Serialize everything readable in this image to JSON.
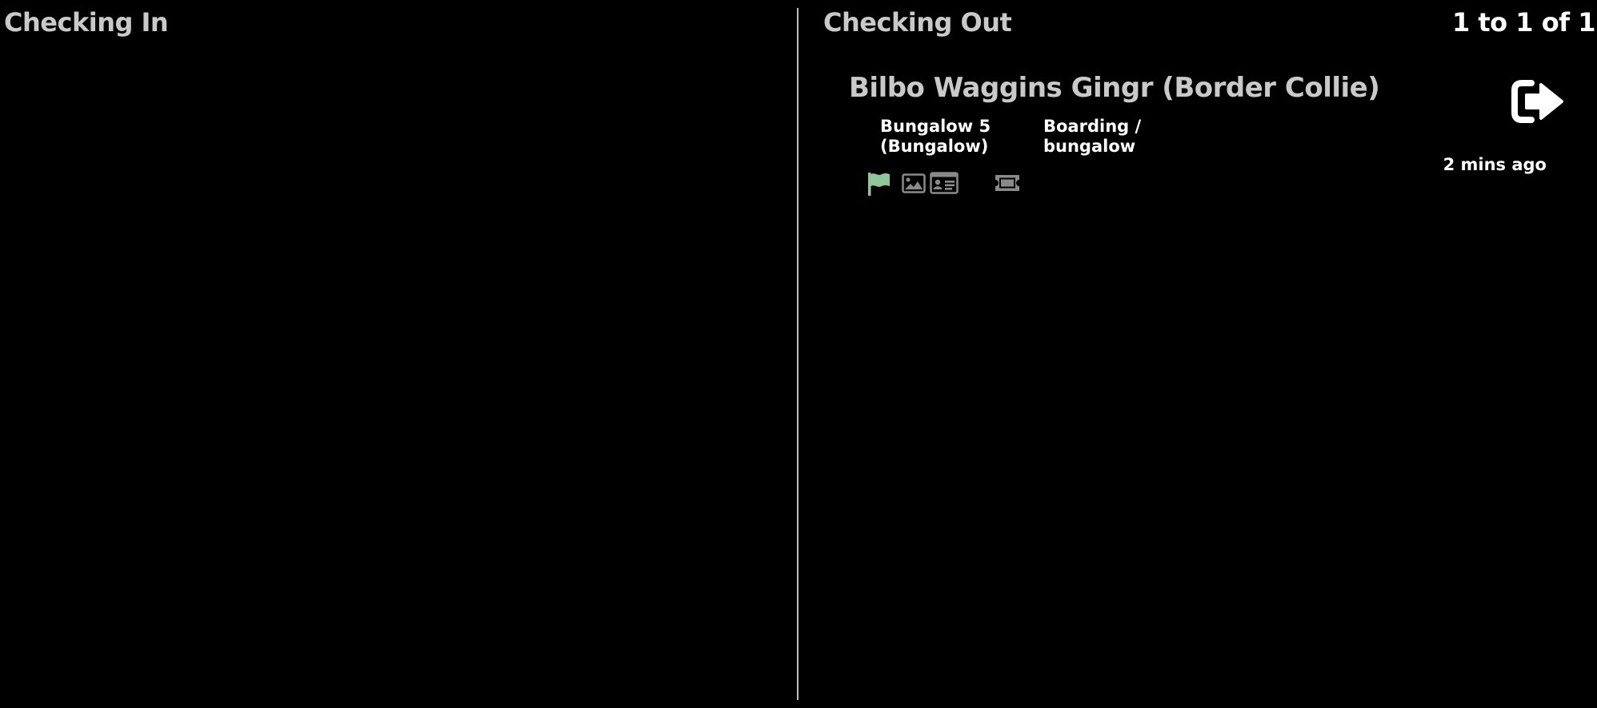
{
  "checking_in": {
    "title": "Checking In"
  },
  "checking_out": {
    "title": "Checking Out",
    "pager": "1 to 1 of 1",
    "items": [
      {
        "name": "Bilbo Waggins Gingr (Border Collie)",
        "location_line1": "Bungalow 5",
        "location_line2": "(Bungalow)",
        "type_line1": "Boarding /",
        "type_line2": "bungalow",
        "time_ago": "2 mins ago",
        "icons": [
          "flag-icon",
          "image-icon",
          "id-card-icon",
          "ticket-icon"
        ],
        "action_icon": "sign-out-icon"
      }
    ]
  },
  "colors": {
    "background": "#000000",
    "heading": "#c9c9c9",
    "text": "#ffffff",
    "flag": "#8fc79a",
    "icon_muted": "#8a8a8a"
  }
}
